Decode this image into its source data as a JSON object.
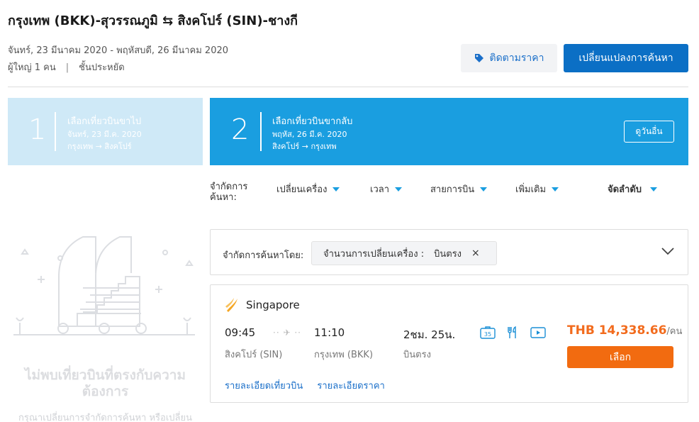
{
  "header": {
    "route": "กรุงเทพ (BKK)-สุวรรณภูมิ ⇆ สิงคโปร์ (SIN)-ชางกี",
    "dates": "จันทร์, 23 มีนาคม 2020 - พฤหัสบดี, 26 มีนาคม 2020",
    "passengers": "ผู้ใหญ่ 1 คน",
    "cabin": "ชั้นประหยัด",
    "track_price": "ติดตามราคา",
    "change_search": "เปลี่ยนแปลงการค้นหา",
    "accent": "#0b6fc5"
  },
  "steps": [
    {
      "num": "1",
      "title": "เลือกเที่ยวบินขาไป",
      "date": "จันทร์, 23 มี.ค. 2020",
      "route": "กรุงเทพ → สิงคโปร์"
    },
    {
      "num": "2",
      "title": "เลือกเที่ยวบินขากลับ",
      "date": "พฤหัส, 26 มี.ค. 2020",
      "route": "สิงคโปร์ → กรุงเทพ",
      "other_days": "ดูวันอื่น"
    }
  ],
  "filters": {
    "label": "จำกัดการค้นหา:",
    "items": [
      "เปลี่ยนเครื่อง",
      "เวลา",
      "สายการบิน",
      "เพิ่มเติม"
    ],
    "sort": "จัดลำดับ"
  },
  "active_limit": {
    "label": "จำกัดการค้นหาโดย:",
    "chip_key": "จำนวนการเปลี่ยนเครื่อง :",
    "chip_value": "บินตรง",
    "remove": "×"
  },
  "flight": {
    "airline": "Singapore",
    "dep_time": "09:45",
    "arr_time": "11:10",
    "duration": "2ชม. 25น.",
    "dep_city": "สิงคโปร์ (SIN)",
    "arr_city": "กรุงเทพ (BKK)",
    "stops": "บินตรง",
    "baggage_kg": "35",
    "price": "THB 14,338.66",
    "per": "/คน",
    "select": "เลือก",
    "flight_details": "รายละเอียดเที่ยวบิน",
    "price_details": "รายละเอียดราคา",
    "price_color": "#f26b1d"
  },
  "empty": {
    "title": "ไม่พบเที่ยวบินที่ตรงกับความต้องการ",
    "subtitle": "กรุณาเปลี่ยนการจำกัดการค้นหา หรือเปลี่ยน"
  }
}
